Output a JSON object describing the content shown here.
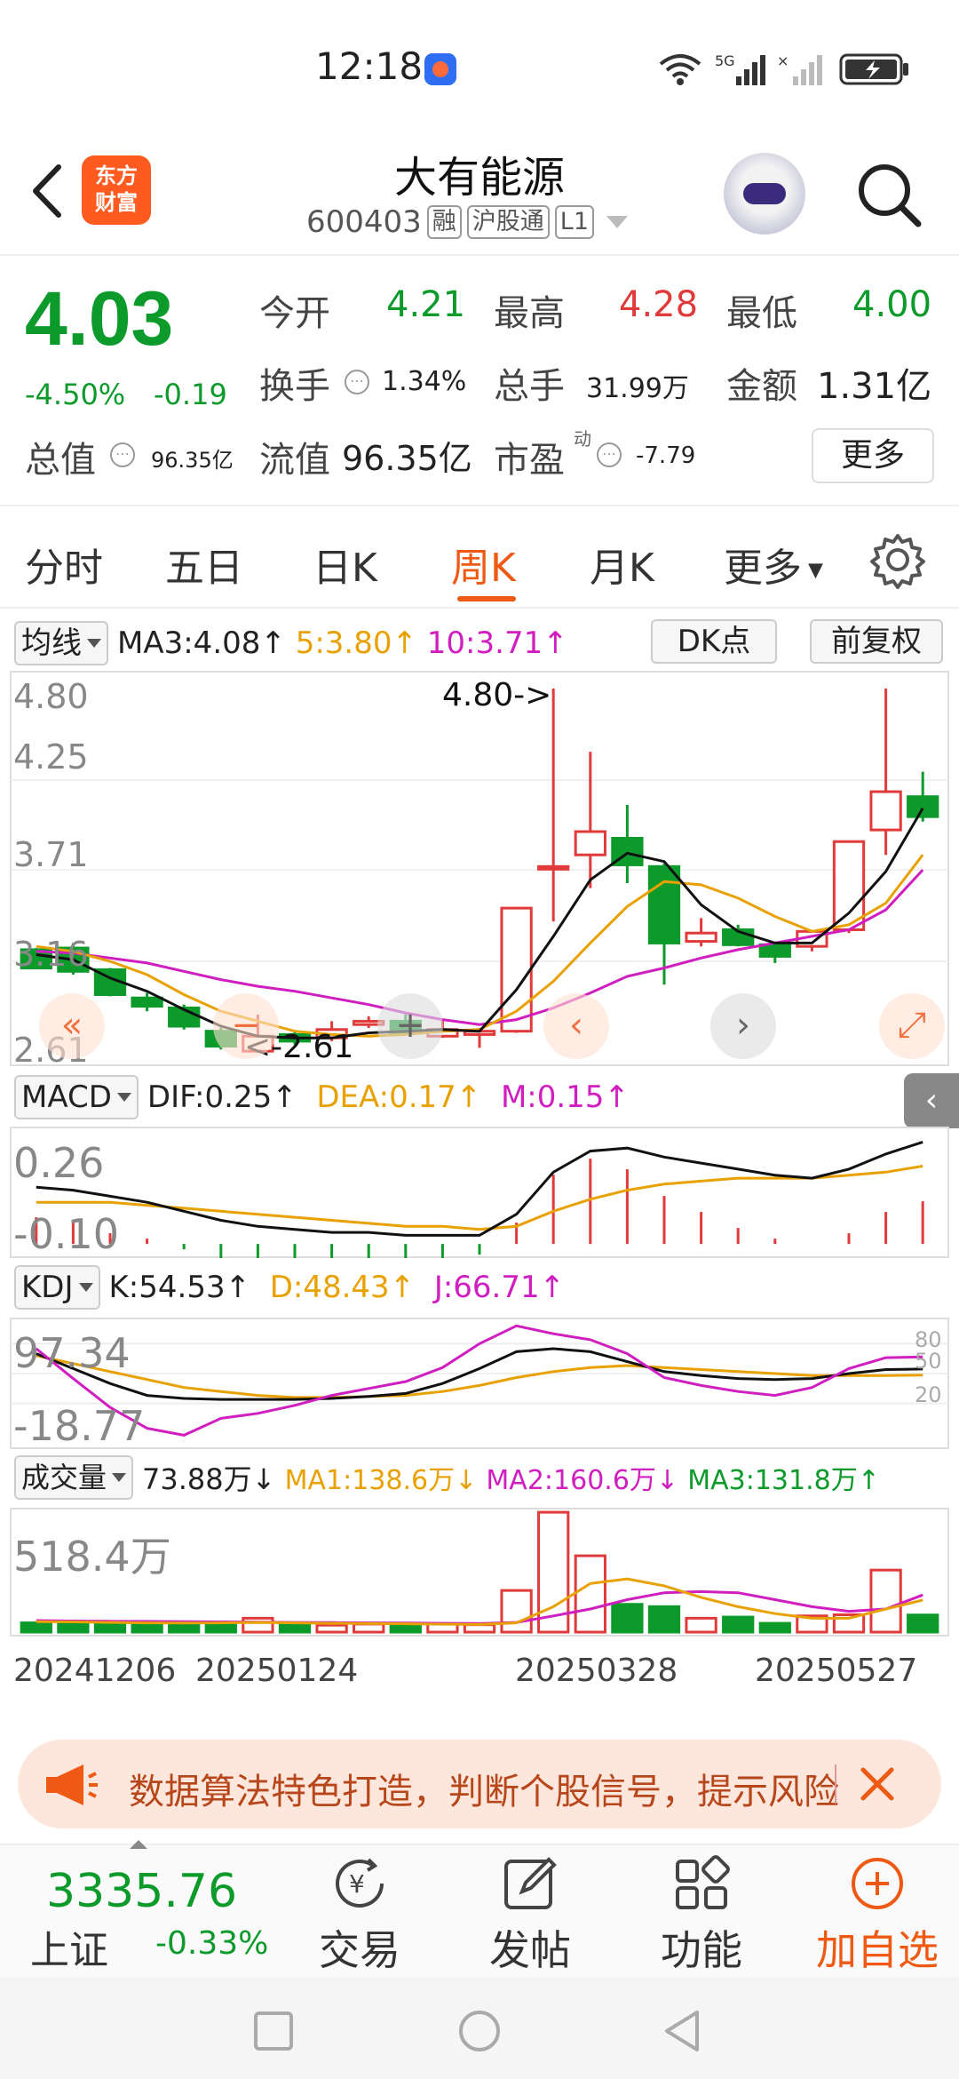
{
  "status_bar": {
    "time": "12:18",
    "signal1": "5G",
    "network": "6"
  },
  "header": {
    "logo_text_1": "东方",
    "logo_text_2": "财富",
    "stock_name": "大有能源",
    "stock_code": "600403",
    "tags": [
      "融",
      "沪股通",
      "L1"
    ]
  },
  "quote": {
    "price": "4.03",
    "change_pct": "-4.50%",
    "change_abs": "-0.19",
    "market_cap_label": "总值",
    "market_cap": "96.35亿",
    "open_label": "今开",
    "open": "4.21",
    "high_label": "最高",
    "high": "4.28",
    "low_label": "最低",
    "low": "4.00",
    "turnover_label": "换手",
    "turnover": "1.34%",
    "volume_label": "总手",
    "volume": "31.99万",
    "amount_label": "金额",
    "amount": "1.31亿",
    "float_cap_label": "流值",
    "float_cap": "96.35亿",
    "pe_label": "市盈",
    "pe_sup": "动",
    "pe": "-7.79",
    "more_label": "更多"
  },
  "tabs": [
    {
      "label": "分时",
      "active": false
    },
    {
      "label": "五日",
      "active": false
    },
    {
      "label": "日K",
      "active": false
    },
    {
      "label": "周K",
      "active": true
    },
    {
      "label": "月K",
      "active": false
    },
    {
      "label": "更多",
      "active": false
    }
  ],
  "ma_bar": {
    "selector": "均线",
    "ma3": "MA3:4.08↑",
    "ma5": "5:3.80↑",
    "ma10": "10:3.71↑",
    "dk": "DK点",
    "adjust": "前复权"
  },
  "price_axis": {
    "top": "4.80",
    "l2": "4.25",
    "l3": "3.71",
    "l4": "3.16",
    "bottom": "2.61"
  },
  "price_annotations": {
    "high_marker": "4.80->",
    "low_marker": "<-2.61"
  },
  "macd_bar": {
    "selector": "MACD",
    "dif": "DIF:0.25↑",
    "dea": "DEA:0.17↑",
    "m": "M:0.15↑"
  },
  "macd_axis": {
    "top": "0.26",
    "bottom": "-0.10"
  },
  "kdj_bar": {
    "selector": "KDJ",
    "k": "K:54.53↑",
    "d": "D:48.43↑",
    "j": "J:66.71↑"
  },
  "kdj_axis": {
    "top": "97.34",
    "bottom": "-18.77",
    "r80": "80",
    "r50": "50",
    "r20": "20"
  },
  "vol_bar": {
    "selector": "成交量",
    "vol": "73.88万↓",
    "ma1": "MA1:138.6万↓",
    "ma2": "MA2:160.6万↓",
    "ma3": "MA3:131.8万↑"
  },
  "vol_axis": {
    "top": "518.4万"
  },
  "date_axis": [
    "20241206",
    "20250124",
    "20250328",
    "20250527"
  ],
  "colors": {
    "up": "#e03a3a",
    "down": "#0c9a2b",
    "ma3": "#111111",
    "ma5": "#e8a100",
    "ma10": "#d01ec0",
    "accent": "#ee5a13"
  },
  "banner": {
    "text": "数据算法特色打造，判断个股信号，提示风险"
  },
  "bottom_nav": {
    "index_value": "3335.76",
    "index_name": "上证",
    "index_pct": "-0.33%",
    "items": [
      "交易",
      "发帖",
      "功能",
      "加自选"
    ]
  },
  "chart_data": {
    "type": "candlestick",
    "period": "weekly",
    "candles": [
      {
        "o": 3.23,
        "h": 3.24,
        "l": 3.12,
        "c": 3.12,
        "up": true
      },
      {
        "o": 3.24,
        "h": 3.27,
        "l": 3.08,
        "c": 3.1,
        "down": true
      },
      {
        "o": 3.11,
        "h": 3.12,
        "l": 2.95,
        "c": 2.96
      },
      {
        "o": 2.94,
        "h": 2.97,
        "l": 2.86,
        "c": 2.89
      },
      {
        "o": 2.88,
        "h": 2.9,
        "l": 2.75,
        "c": 2.77
      },
      {
        "o": 2.74,
        "h": 2.76,
        "l": 2.63,
        "c": 2.65
      },
      {
        "o": 2.62,
        "h": 2.84,
        "l": 2.61,
        "c": 2.71
      },
      {
        "o": 2.72,
        "h": 2.74,
        "l": 2.66,
        "c": 2.68
      },
      {
        "o": 2.7,
        "h": 2.8,
        "l": 2.68,
        "c": 2.75
      },
      {
        "o": 2.78,
        "h": 2.83,
        "l": 2.76,
        "c": 2.8
      },
      {
        "o": 2.8,
        "h": 2.84,
        "l": 2.72,
        "c": 2.73
      },
      {
        "o": 2.71,
        "h": 2.81,
        "l": 2.7,
        "c": 2.75
      },
      {
        "o": 2.72,
        "h": 2.76,
        "l": 2.64,
        "c": 2.74
      },
      {
        "o": 2.74,
        "h": 3.48,
        "l": 2.73,
        "c": 3.48
      },
      {
        "o": 3.73,
        "h": 4.8,
        "l": 3.4,
        "c": 3.73
      },
      {
        "o": 3.8,
        "h": 4.42,
        "l": 3.6,
        "c": 3.94
      },
      {
        "o": 3.9,
        "h": 4.1,
        "l": 3.63,
        "c": 3.74
      },
      {
        "o": 3.73,
        "h": 3.75,
        "l": 3.02,
        "c": 3.27
      },
      {
        "o": 3.28,
        "h": 3.42,
        "l": 3.25,
        "c": 3.33
      },
      {
        "o": 3.35,
        "h": 3.38,
        "l": 3.25,
        "c": 3.26
      },
      {
        "o": 3.26,
        "h": 3.27,
        "l": 3.15,
        "c": 3.19
      },
      {
        "o": 3.25,
        "h": 3.28,
        "l": 3.22,
        "c": 3.34
      },
      {
        "o": 3.35,
        "h": 3.88,
        "l": 3.33,
        "c": 3.88
      },
      {
        "o": 3.95,
        "h": 4.8,
        "l": 3.8,
        "c": 4.18
      },
      {
        "o": 4.15,
        "h": 4.3,
        "l": 4.0,
        "c": 4.03
      }
    ],
    "ma3": [
      3.2,
      3.17,
      3.06,
      2.98,
      2.87,
      2.77,
      2.71,
      2.7,
      2.7,
      2.73,
      2.74,
      2.75,
      2.74,
      2.99,
      3.31,
      3.65,
      3.81,
      3.76,
      3.5,
      3.34,
      3.27,
      3.27,
      3.45,
      3.7,
      4.08
    ],
    "ma5": [
      3.25,
      3.22,
      3.16,
      3.08,
      2.96,
      2.86,
      2.8,
      2.74,
      2.72,
      2.71,
      2.72,
      2.74,
      2.75,
      2.86,
      3.04,
      3.27,
      3.49,
      3.64,
      3.62,
      3.54,
      3.43,
      3.34,
      3.38,
      3.51,
      3.8
    ],
    "ma10": [
      3.22,
      3.21,
      3.18,
      3.15,
      3.1,
      3.05,
      3.01,
      2.98,
      2.94,
      2.9,
      2.85,
      2.81,
      2.78,
      2.81,
      2.88,
      2.97,
      3.07,
      3.12,
      3.18,
      3.23,
      3.27,
      3.31,
      3.35,
      3.47,
      3.71
    ],
    "y_range": [
      2.61,
      4.8
    ],
    "macd": {
      "dif": [
        0.1,
        0.09,
        0.07,
        0.05,
        0.02,
        -0.01,
        -0.03,
        -0.04,
        -0.05,
        -0.05,
        -0.06,
        -0.06,
        -0.06,
        0.01,
        0.15,
        0.22,
        0.23,
        0.2,
        0.18,
        0.16,
        0.14,
        0.13,
        0.16,
        0.21,
        0.25
      ],
      "dea": [
        0.05,
        0.05,
        0.05,
        0.04,
        0.03,
        0.02,
        0.01,
        0.0,
        -0.01,
        -0.02,
        -0.03,
        -0.03,
        -0.04,
        -0.03,
        0.02,
        0.06,
        0.09,
        0.11,
        0.12,
        0.13,
        0.13,
        0.13,
        0.14,
        0.15,
        0.17
      ],
      "y_range": [
        -0.1,
        0.26
      ]
    },
    "kdj": {
      "k": [
        70,
        55,
        40,
        28,
        25,
        24,
        24,
        24,
        25,
        27,
        30,
        40,
        55,
        72,
        75,
        72,
        62,
        52,
        48,
        45,
        44,
        45,
        50,
        54,
        54.53
      ],
      "d": [
        68,
        60,
        52,
        44,
        36,
        32,
        28,
        26,
        26,
        27,
        28,
        32,
        38,
        46,
        52,
        56,
        58,
        56,
        54,
        52,
        50,
        48,
        48,
        48,
        48.43
      ],
      "j": [
        75,
        45,
        16,
        -5,
        -12,
        5,
        10,
        18,
        28,
        35,
        42,
        56,
        80,
        98,
        90,
        84,
        70,
        46,
        38,
        32,
        28,
        36,
        55,
        66,
        66.71
      ],
      "y_range": [
        -18.77,
        97.34
      ]
    },
    "volume": {
      "values": [
        40,
        42,
        40,
        38,
        35,
        42,
        60,
        38,
        30,
        35,
        30,
        35,
        32,
        180,
        518,
        330,
        120,
        110,
        60,
        65,
        38,
        70,
        75,
        268,
        73.88
      ],
      "ma1": [
        45,
        44,
        42,
        40,
        39,
        40,
        42,
        40,
        38,
        37,
        36,
        34,
        33,
        40,
        110,
        210,
        230,
        200,
        150,
        110,
        80,
        60,
        60,
        100,
        138.6
      ],
      "ma2": [
        50,
        48,
        47,
        46,
        45,
        44,
        43,
        42,
        41,
        40,
        39,
        38,
        37,
        42,
        70,
        100,
        140,
        170,
        175,
        170,
        140,
        110,
        90,
        100,
        160.6
      ],
      "y_max": 518.4
    }
  }
}
